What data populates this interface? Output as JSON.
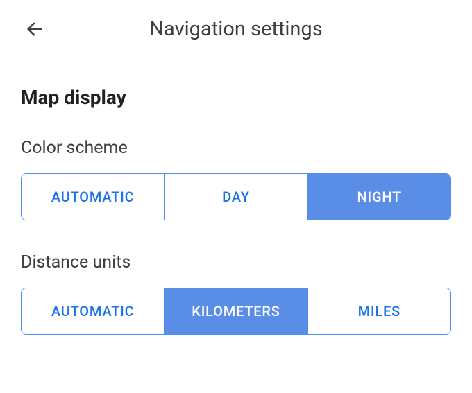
{
  "header": {
    "title": "Navigation settings"
  },
  "section": {
    "heading": "Map display"
  },
  "color_scheme": {
    "label": "Color scheme",
    "options": {
      "automatic": "AUTOMATIC",
      "day": "DAY",
      "night": "NIGHT"
    },
    "selected": "night"
  },
  "distance_units": {
    "label": "Distance units",
    "options": {
      "automatic": "AUTOMATIC",
      "kilometers": "KILOMETERS",
      "miles": "MILES"
    },
    "selected": "kilometers"
  }
}
